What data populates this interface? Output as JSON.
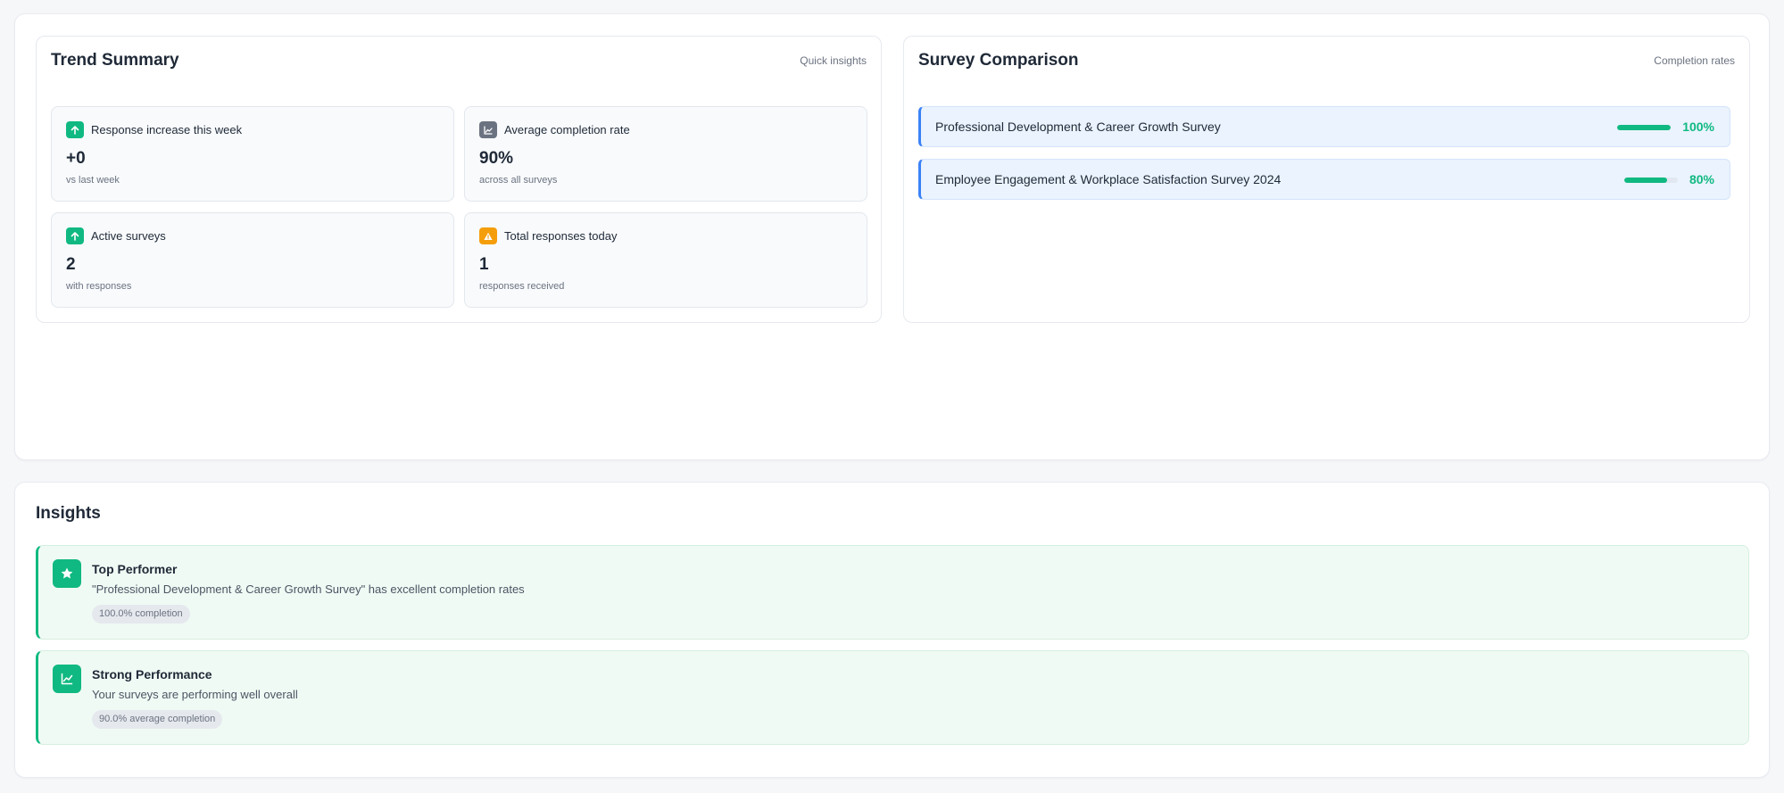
{
  "trend_summary": {
    "title": "Trend Summary",
    "subtitle": "Quick insights",
    "stats": [
      {
        "icon": "arrow-up-icon",
        "icon_color": "#10b981",
        "label": "Response increase this week",
        "value": "+0",
        "sub": "vs last week"
      },
      {
        "icon": "chart-line-icon",
        "icon_color": "#6b7280",
        "label": "Average completion rate",
        "value": "90%",
        "sub": "across all surveys"
      },
      {
        "icon": "arrow-up-icon",
        "icon_color": "#10b981",
        "label": "Active surveys",
        "value": "2",
        "sub": "with responses"
      },
      {
        "icon": "warning-icon",
        "icon_color": "#f59e0b",
        "label": "Total responses today",
        "value": "1",
        "sub": "responses received"
      }
    ]
  },
  "survey_comparison": {
    "title": "Survey Comparison",
    "subtitle": "Completion rates",
    "surveys": [
      {
        "name": "Professional Development & Career Growth Survey",
        "completion_label": "100%",
        "completion": 1.0
      },
      {
        "name": "Employee Engagement & Workplace Satisfaction Survey 2024",
        "completion_label": "80%",
        "completion": 0.8
      }
    ]
  },
  "insights": {
    "title": "Insights",
    "items": [
      {
        "icon": "star-icon",
        "title": "Top Performer",
        "description": "\"Professional Development & Career Growth Survey\" has excellent completion rates",
        "badge": "100.0% completion"
      },
      {
        "icon": "chart-line-icon",
        "title": "Strong Performance",
        "description": "Your surveys are performing well overall",
        "badge": "90.0% average completion"
      }
    ]
  },
  "colors": {
    "accent_green": "#10b981",
    "accent_blue": "#3b82f6",
    "warning_orange": "#f59e0b"
  }
}
